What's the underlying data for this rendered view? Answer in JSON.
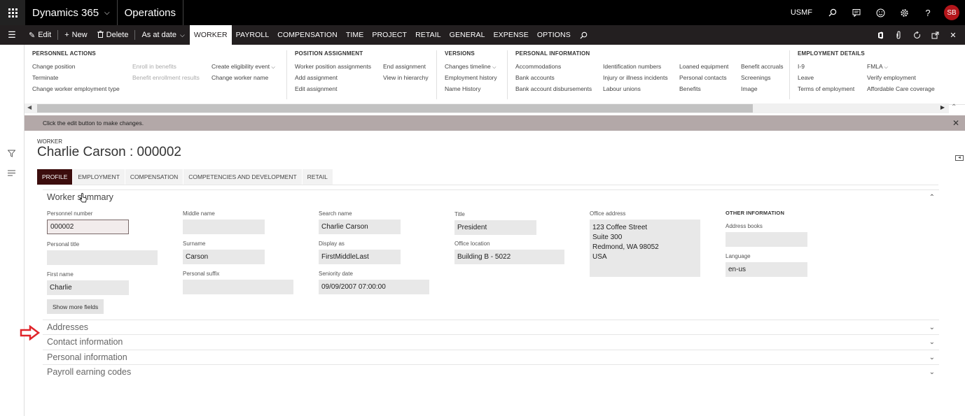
{
  "topbar": {
    "app_title": "Dynamics 365",
    "module": "Operations",
    "company": "USMF",
    "avatar_initials": "SB"
  },
  "actionbar": {
    "edit": "Edit",
    "new": "New",
    "delete": "Delete",
    "as_at_date": "As at date",
    "tabs": [
      "WORKER",
      "PAYROLL",
      "COMPENSATION",
      "TIME",
      "PROJECT",
      "RETAIL",
      "GENERAL",
      "EXPENSE",
      "OPTIONS"
    ],
    "active_tab": "WORKER"
  },
  "ribbon": {
    "personnel_actions": {
      "title": "PERSONNEL ACTIONS",
      "col1": [
        "Change position",
        "Terminate",
        "Change worker employment type"
      ],
      "col2": [
        "Enroll in benefits",
        "Benefit enrollment results"
      ],
      "col3": [
        "Create eligibility event",
        "Change worker name"
      ]
    },
    "position_assignment": {
      "title": "POSITION ASSIGNMENT",
      "col1": [
        "Worker position assignments",
        "Add assignment",
        "Edit assignment"
      ],
      "col2": [
        "End assignment",
        "View in hierarchy"
      ]
    },
    "versions": {
      "title": "VERSIONS",
      "col1": [
        "Changes timeline",
        "Employment history",
        "Name History"
      ]
    },
    "personal_information": {
      "title": "PERSONAL INFORMATION",
      "col1": [
        "Accommodations",
        "Bank accounts",
        "Bank account disbursements"
      ],
      "col2": [
        "Identification numbers",
        "Injury or illness incidents",
        "Labour unions"
      ],
      "col3": [
        "Loaned equipment",
        "Personal contacts",
        "Benefits"
      ],
      "col4": [
        "Benefit accruals",
        "Screenings",
        "Image"
      ]
    },
    "employment_details": {
      "title": "EMPLOYMENT DETAILS",
      "col1": [
        "I-9",
        "Leave",
        "Terms of employment"
      ],
      "col2": [
        "FMLA",
        "Verify employment",
        "Affordable Care coverage"
      ]
    }
  },
  "message": "Click the edit button to make changes.",
  "form": {
    "caption": "WORKER",
    "title": "Charlie Carson : 000002",
    "tabs": [
      "PROFILE",
      "EMPLOYMENT",
      "COMPENSATION",
      "COMPETENCIES AND DEVELOPMENT",
      "RETAIL"
    ]
  },
  "worker_summary": {
    "title": "Worker summary",
    "personnel_number": {
      "label": "Personnel number",
      "value": "000002"
    },
    "personal_title": {
      "label": "Personal title",
      "value": ""
    },
    "first_name": {
      "label": "First name",
      "value": "Charlie"
    },
    "middle_name": {
      "label": "Middle name",
      "value": ""
    },
    "surname": {
      "label": "Surname",
      "value": "Carson"
    },
    "personal_suffix": {
      "label": "Personal suffix",
      "value": ""
    },
    "search_name": {
      "label": "Search name",
      "value": "Charlie Carson"
    },
    "display_as": {
      "label": "Display as",
      "value": "FirstMiddleLast"
    },
    "seniority_date": {
      "label": "Seniority date",
      "value": "09/09/2007 07:00:00"
    },
    "title_field": {
      "label": "Title",
      "value": "President"
    },
    "office_location": {
      "label": "Office location",
      "value": "Building B - 5022"
    },
    "office_address": {
      "label": "Office address",
      "lines": [
        "123 Coffee Street",
        "Suite 300",
        "Redmond, WA 98052",
        "USA"
      ]
    },
    "other_info_header": "OTHER INFORMATION",
    "address_books": {
      "label": "Address books",
      "value": ""
    },
    "language": {
      "label": "Language",
      "value": "en-us"
    },
    "show_more": "Show more fields"
  },
  "fasttabs": [
    "Addresses",
    "Contact information",
    "Personal information",
    "Payroll earning codes"
  ],
  "colors": {
    "topbar": "#000000",
    "actionbar": "#231f20",
    "active_tab": "#3c0d0d",
    "message_bar": "#b3a8a8",
    "arrow": "#e0242a"
  }
}
